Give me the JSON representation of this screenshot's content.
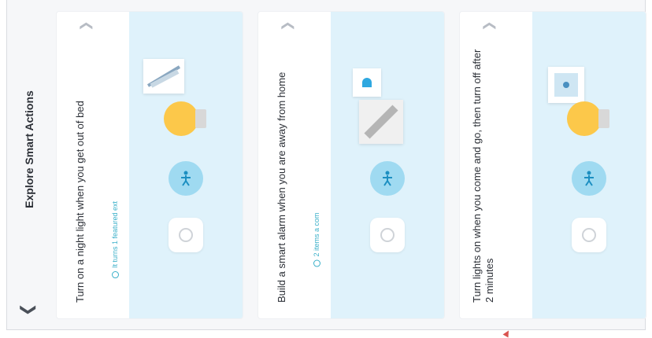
{
  "section": {
    "title": "Explore Smart Actions",
    "collapse_icon": "chevron-down-icon"
  },
  "cards": [
    {
      "description": "Turn on a night light when you get out of bed",
      "meta": "It turns 1 featured ext",
      "chevron_icon": "chevron-up-icon"
    },
    {
      "description": "Build a smart alarm when you are away from home",
      "meta": "2 items a com",
      "chevron_icon": "chevron-up-icon"
    },
    {
      "description": "Turn lights on when you come and go, then turn off after 2 minutes",
      "meta": "",
      "chevron_icon": "chevron-up-icon"
    }
  ],
  "colors": {
    "accent": "#3bb0c9",
    "illustration_bg": "#dff2fb",
    "bulb": "#fcc84a",
    "motion": "#9fdaf1"
  }
}
